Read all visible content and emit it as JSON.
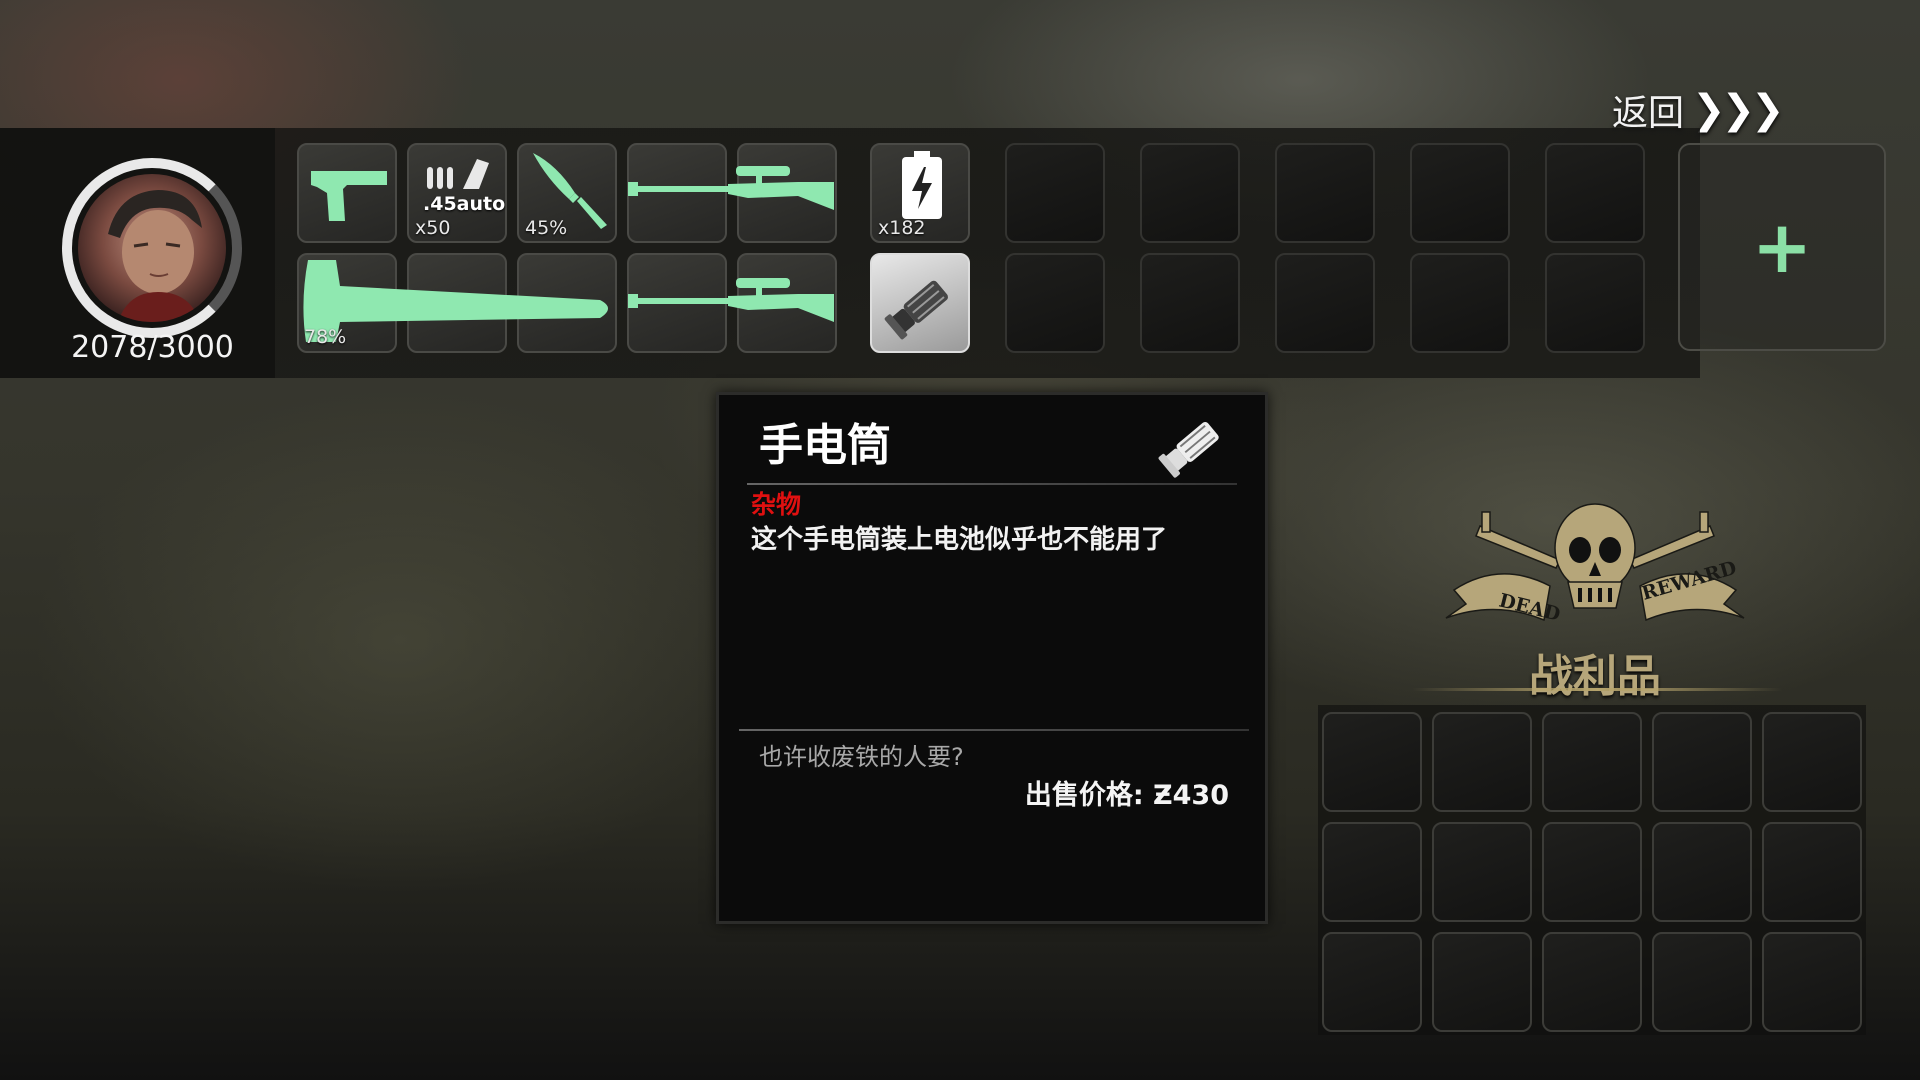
{
  "header": {
    "back_label": "返回",
    "back_arrows": "❯❯❯"
  },
  "player": {
    "hp_text": "2078/3000"
  },
  "inventory": {
    "pistol": {
      "icon": "pistol-icon"
    },
    "ammo": {
      "caliber": ".45auto",
      "count": "x50",
      "icon": "ammo-icon"
    },
    "knife": {
      "durability": "45%",
      "icon": "knife-icon"
    },
    "rifle_1": {
      "icon": "rifle-icon"
    },
    "battery": {
      "count": "x182",
      "icon": "battery-icon"
    },
    "axe": {
      "durability": "78%",
      "icon": "axe-icon"
    },
    "rifle_2": {
      "icon": "rifle-icon"
    },
    "flashlight": {
      "icon": "flashlight-icon"
    },
    "add_label": "+"
  },
  "tooltip": {
    "title": "手电筒",
    "category": "杂物",
    "description": "这个手电筒装上电池似乎也不能用了",
    "flavor": "也许收废铁的人要?",
    "price": "出售价格: Ƶ430",
    "icon": "flashlight-icon"
  },
  "reward": {
    "title": "战利品",
    "emblem_left": "DEAD",
    "emblem_right": "REWARD",
    "icon": "skull-crossed-rifles-icon"
  },
  "colors": {
    "item_green": "#8fe8b0",
    "category_red": "#e01010",
    "reward_gold": "#b6a67a"
  }
}
